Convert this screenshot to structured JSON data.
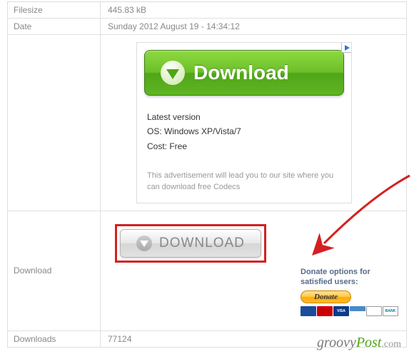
{
  "rows": {
    "filesize": {
      "label": "Filesize",
      "value": "445.83 kB"
    },
    "date": {
      "label": "Date",
      "value": "Sunday 2012 August 19 - 14:34:12"
    },
    "download": {
      "label": "Download"
    },
    "downloads": {
      "label": "Downloads",
      "value": "77124"
    }
  },
  "ad": {
    "button_text": "Download",
    "line1": "Latest version",
    "line2": "OS: Windows XP/Vista/7",
    "line3": "Cost: Free",
    "disclaimer": "This advertisement will lead you to our site where you can download free Codecs"
  },
  "download_button": {
    "text": "DOWNLOAD"
  },
  "donate": {
    "label": "Donate options for satisfied users:",
    "button": "Donate"
  },
  "watermark": {
    "part1": "groovy",
    "part2": "Post",
    "suffix": ".com"
  }
}
